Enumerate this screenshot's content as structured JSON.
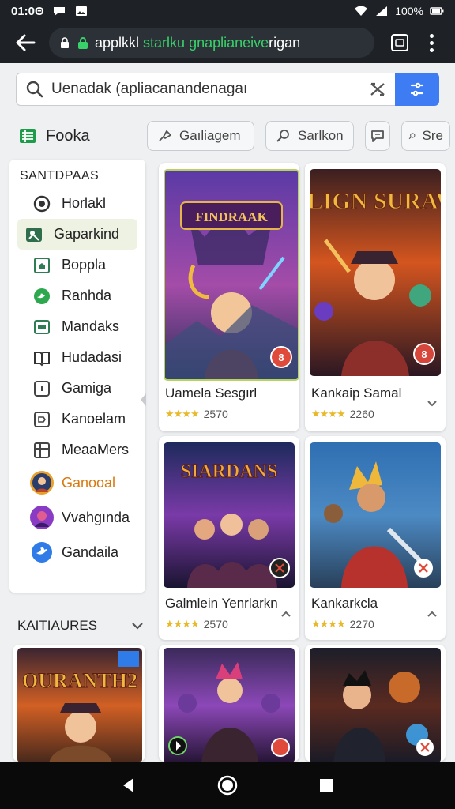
{
  "status_bar": {
    "time": "01:0Θ",
    "battery": "100%"
  },
  "browser": {
    "url_prefix": "applkkl",
    "url_green": "starlku gnaplianeive",
    "url_suffix": "rigan"
  },
  "search": {
    "value": "Uenadak (apliacanandenagaı"
  },
  "filters": {
    "brand_label": "Fooka",
    "chips": [
      "Gaıliagem",
      "Sarlkon",
      "",
      "Sre"
    ]
  },
  "sidebar": {
    "title": "SANTDPAAS",
    "items": [
      {
        "label": "Horlakl",
        "icon": "target-icon"
      },
      {
        "label": "Gaparkind",
        "icon": "map-marker-icon",
        "active": true
      },
      {
        "label": "Boppla",
        "icon": "home-icon"
      },
      {
        "label": "Ranhda",
        "icon": "bird-icon"
      },
      {
        "label": "Mandaks",
        "icon": "dashboard-icon"
      },
      {
        "label": "Hudadasi",
        "icon": "book-icon"
      },
      {
        "label": "Gamiga",
        "icon": "tile-icon"
      },
      {
        "label": "Kanoelam",
        "icon": "tag-icon"
      },
      {
        "label": "MeaaMers",
        "icon": "grid-icon"
      },
      {
        "label": "Ganooal",
        "icon": "avatar-warrior",
        "highlight": true
      },
      {
        "label": "Vvahgında",
        "icon": "avatar-purple"
      },
      {
        "label": "Gandaila",
        "icon": "avatar-blue"
      }
    ]
  },
  "features_header": "KAITIAURES",
  "cards": [
    {
      "banner": "FINDRAAK",
      "title": "Uamela Sesgırl",
      "rating": "2570",
      "stars": "★★★★",
      "badge": "8"
    },
    {
      "banner": "SALIGN SURAWA",
      "title": "Kankaip Samal",
      "rating": "2260",
      "stars": "★★★★",
      "badge": "8"
    },
    {
      "banner": "SIARDANS",
      "title": "Galmlein Yenrlarkn",
      "rating": "2570",
      "stars": "★★★★",
      "badge": ""
    },
    {
      "banner": "",
      "title": "Kankarkcla",
      "rating": "2270",
      "stars": "★★★★",
      "badge": ""
    },
    {
      "banner": "OURANTH2",
      "title": "",
      "rating": "",
      "stars": "",
      "badge": ""
    },
    {
      "banner": "",
      "title": "",
      "rating": "",
      "stars": "",
      "badge": ""
    },
    {
      "banner": "",
      "title": "",
      "rating": "",
      "stars": "",
      "badge": ""
    }
  ],
  "colors": {
    "accent": "#3d7cf2",
    "url_green": "#38d16a",
    "bar_bg": "#1e2227",
    "star": "#e8b92a"
  }
}
